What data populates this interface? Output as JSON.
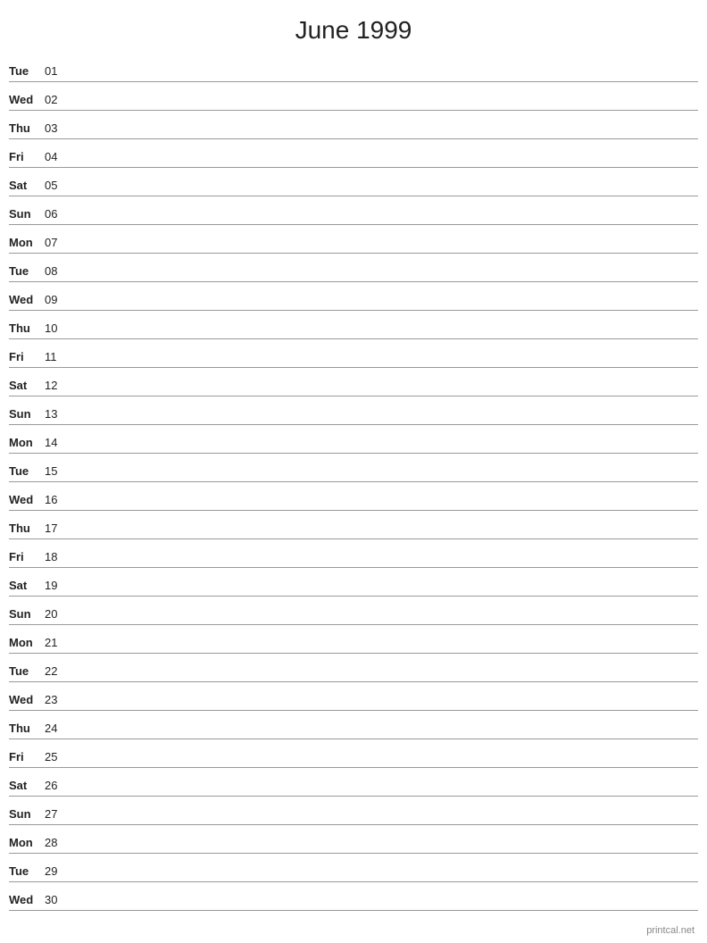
{
  "title": "June 1999",
  "footer": "printcal.net",
  "days": [
    {
      "day": "Tue",
      "date": "01"
    },
    {
      "day": "Wed",
      "date": "02"
    },
    {
      "day": "Thu",
      "date": "03"
    },
    {
      "day": "Fri",
      "date": "04"
    },
    {
      "day": "Sat",
      "date": "05"
    },
    {
      "day": "Sun",
      "date": "06"
    },
    {
      "day": "Mon",
      "date": "07"
    },
    {
      "day": "Tue",
      "date": "08"
    },
    {
      "day": "Wed",
      "date": "09"
    },
    {
      "day": "Thu",
      "date": "10"
    },
    {
      "day": "Fri",
      "date": "11"
    },
    {
      "day": "Sat",
      "date": "12"
    },
    {
      "day": "Sun",
      "date": "13"
    },
    {
      "day": "Mon",
      "date": "14"
    },
    {
      "day": "Tue",
      "date": "15"
    },
    {
      "day": "Wed",
      "date": "16"
    },
    {
      "day": "Thu",
      "date": "17"
    },
    {
      "day": "Fri",
      "date": "18"
    },
    {
      "day": "Sat",
      "date": "19"
    },
    {
      "day": "Sun",
      "date": "20"
    },
    {
      "day": "Mon",
      "date": "21"
    },
    {
      "day": "Tue",
      "date": "22"
    },
    {
      "day": "Wed",
      "date": "23"
    },
    {
      "day": "Thu",
      "date": "24"
    },
    {
      "day": "Fri",
      "date": "25"
    },
    {
      "day": "Sat",
      "date": "26"
    },
    {
      "day": "Sun",
      "date": "27"
    },
    {
      "day": "Mon",
      "date": "28"
    },
    {
      "day": "Tue",
      "date": "29"
    },
    {
      "day": "Wed",
      "date": "30"
    }
  ]
}
